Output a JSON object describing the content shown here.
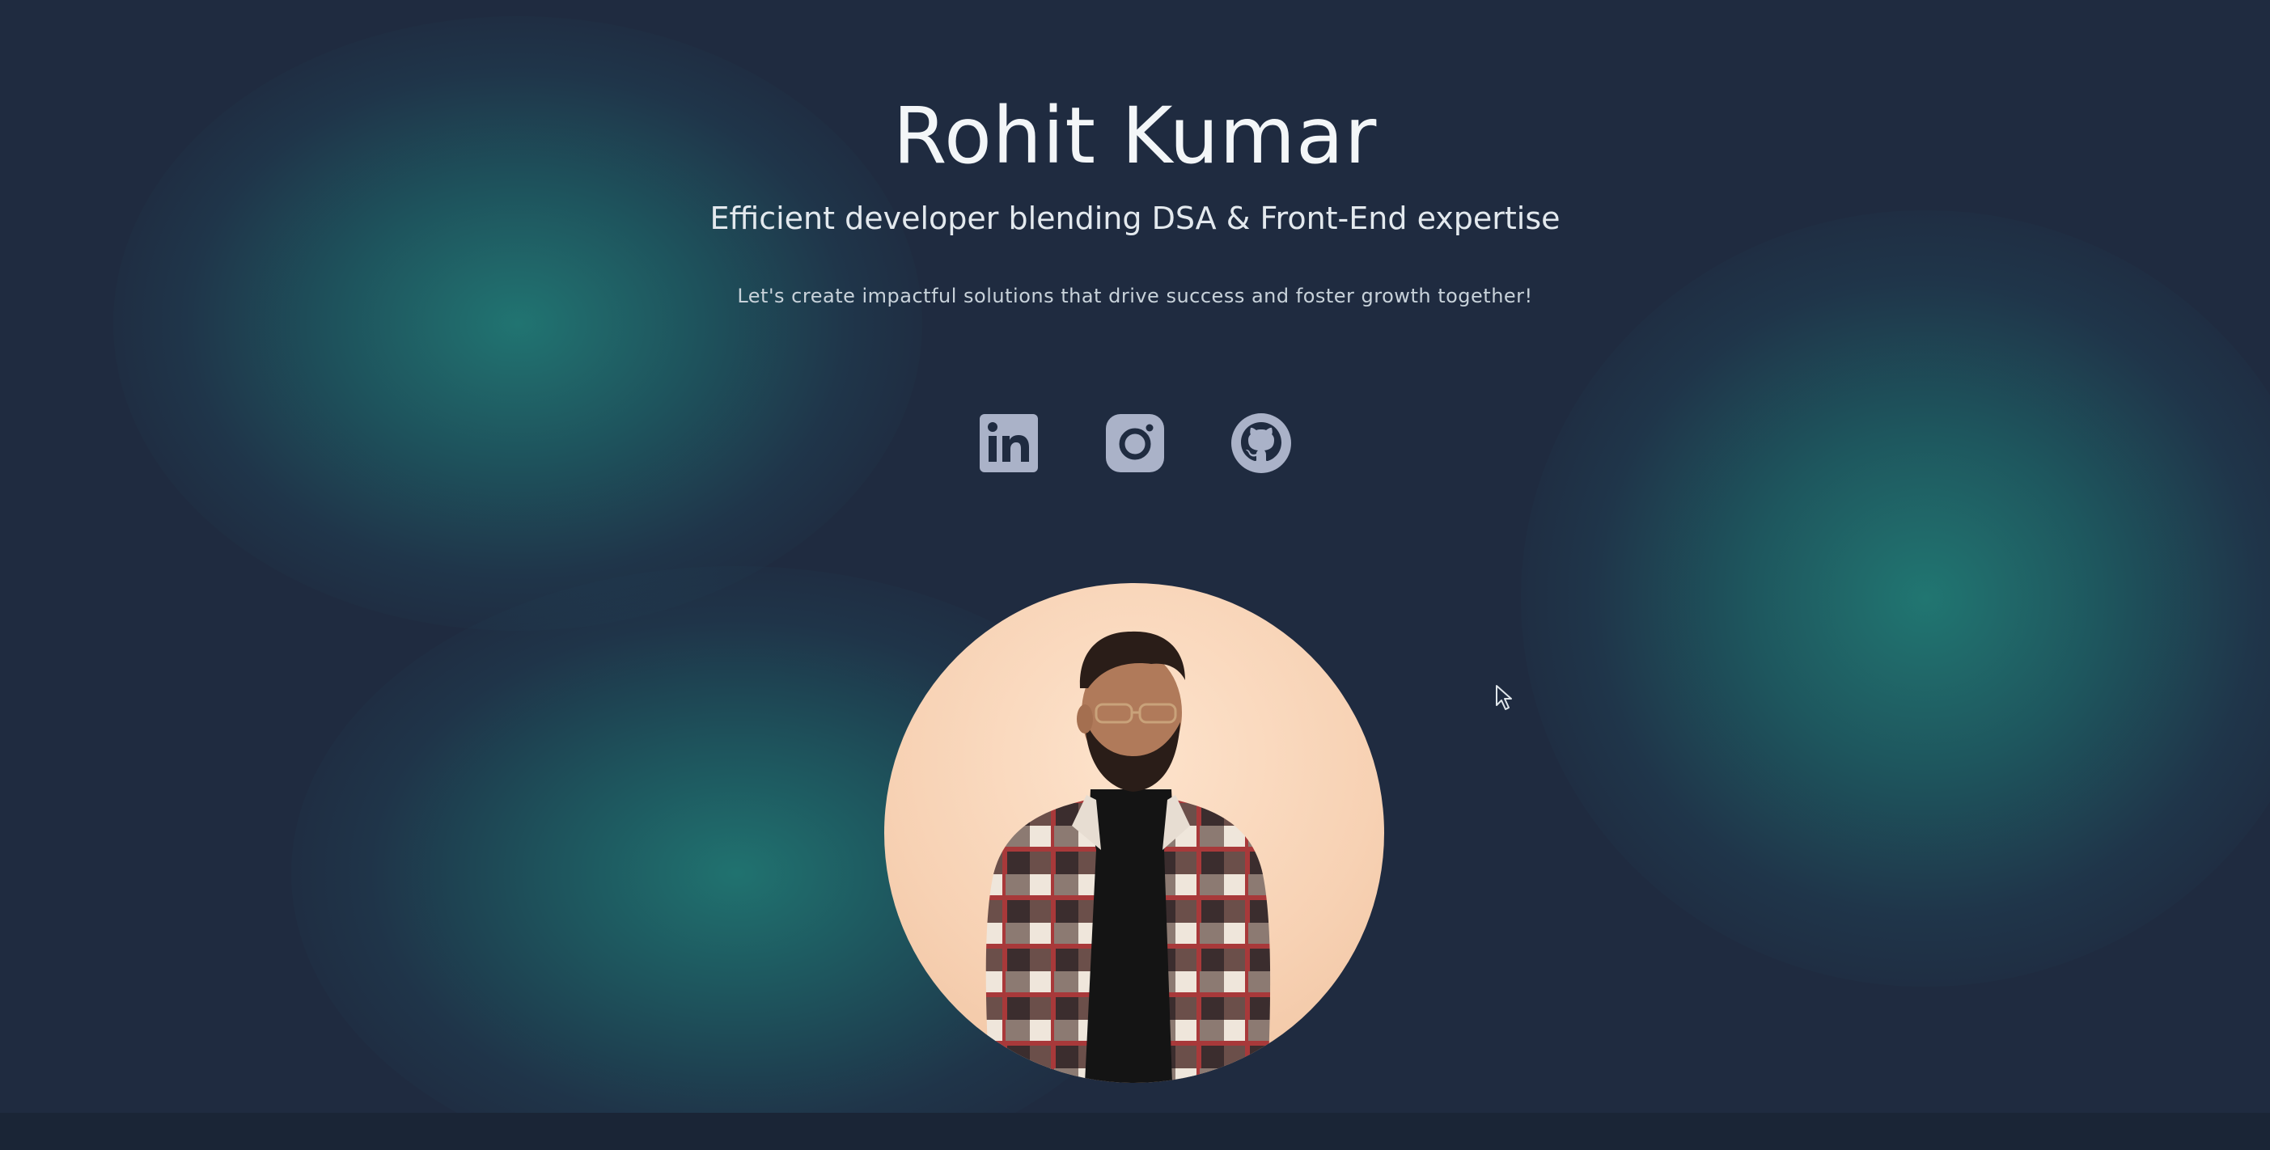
{
  "hero": {
    "name": "Rohit Kumar",
    "tagline": "Efficient developer blending DSA & Front-End expertise",
    "subline": "Let's create impactful solutions that drive success and foster growth together!"
  },
  "socials": [
    {
      "icon": "linkedin-icon"
    },
    {
      "icon": "instagram-icon"
    },
    {
      "icon": "github-icon"
    }
  ],
  "avatar": {
    "icon": "profile-photo"
  },
  "colors": {
    "background": "#1f2b40",
    "glow": "#217874",
    "icon": "#aab2c8",
    "avatar_bg": "#f7d1b3"
  }
}
